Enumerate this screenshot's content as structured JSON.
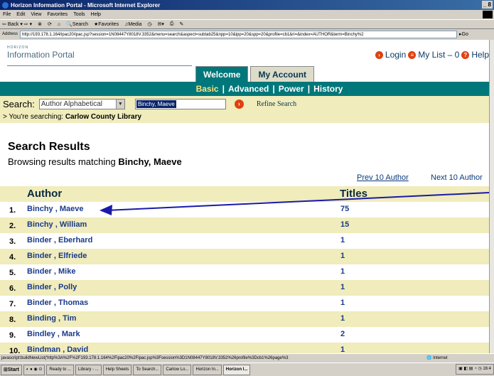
{
  "window": {
    "title": "Horizon Information Portal - Microsoft Internet Explorer",
    "controls": "_ 8"
  },
  "menu": [
    "File",
    "Edit",
    "View",
    "Favorites",
    "Tools",
    "Help"
  ],
  "toolbar": [
    "Back",
    "Search",
    "Favorites",
    "Media"
  ],
  "address": {
    "label": "Address",
    "url": "http://193.178.1.164/ipac20/ipac.jsp?session=1N08447Y8018V.3352&menu=search&aspect=subtab25&npp=10&ipp=20&spp=20&profile=cb1&ri=&index=AUTHOR&term=Binchy%2",
    "go": "Go"
  },
  "portal": {
    "logo_small": "HORIZON",
    "logo_big": "Information Portal",
    "login": "Login",
    "mylist": "My List – 0",
    "help": "Help",
    "tabs": [
      {
        "label": "Welcome"
      },
      {
        "label": "My Account"
      }
    ],
    "subnav": [
      "Basic",
      "Advanced",
      "Power",
      "History"
    ]
  },
  "search": {
    "label": "Search:",
    "type_selected": "Author Alphabetical",
    "term": "Binchy, Maeve",
    "refine": "Refine Search",
    "scope_prefix": "> You're searching: ",
    "scope": "Carlow County Library"
  },
  "results": {
    "title": "Search Results",
    "browsing_prefix": "Browsing results matching ",
    "browsing_term": "Binchy, Maeve",
    "prev": "Prev 10 Author",
    "next": "Next 10 Author",
    "col_author": "Author",
    "col_titles": "Titles",
    "rows": [
      {
        "num": "1.",
        "author": "Binchy , Maeve",
        "titles": "75"
      },
      {
        "num": "2.",
        "author": "Binchy , William",
        "titles": "15"
      },
      {
        "num": "3.",
        "author": "Binder , Eberhard",
        "titles": "1"
      },
      {
        "num": "4.",
        "author": "Binder , Elfriede",
        "titles": "1"
      },
      {
        "num": "5.",
        "author": "Binder , Mike",
        "titles": "1"
      },
      {
        "num": "6.",
        "author": "Binder , Polly",
        "titles": "1"
      },
      {
        "num": "7.",
        "author": "Binder , Thomas",
        "titles": "1"
      },
      {
        "num": "8.",
        "author": "Binding , Tim",
        "titles": "1"
      },
      {
        "num": "9.",
        "author": "Bindley , Mark",
        "titles": "2"
      },
      {
        "num": "10.",
        "author": "Bindman , David",
        "titles": "1"
      }
    ]
  },
  "status": {
    "url": "javascript:buildNewList('http%3A%2F%2F193.178.1.164%2Fipac20%2Fipac.jsp%3Fsession%3D1N08447Y8018V.3352%26profile%3Dcb1%26page%3",
    "zone": "Internet"
  },
  "taskbar": {
    "start": "Start",
    "buttons": [
      "Ready to ...",
      "Library - ...",
      "Help Sheets",
      "To Search...",
      "Carlow Lo...",
      "Horizon In...",
      "Horizon I..."
    ],
    "clock": "16:4"
  },
  "colors": {
    "teal": "#00777a",
    "cream": "#f0ecbc",
    "link": "#1a3a8a",
    "accent_red": "#e04010"
  }
}
